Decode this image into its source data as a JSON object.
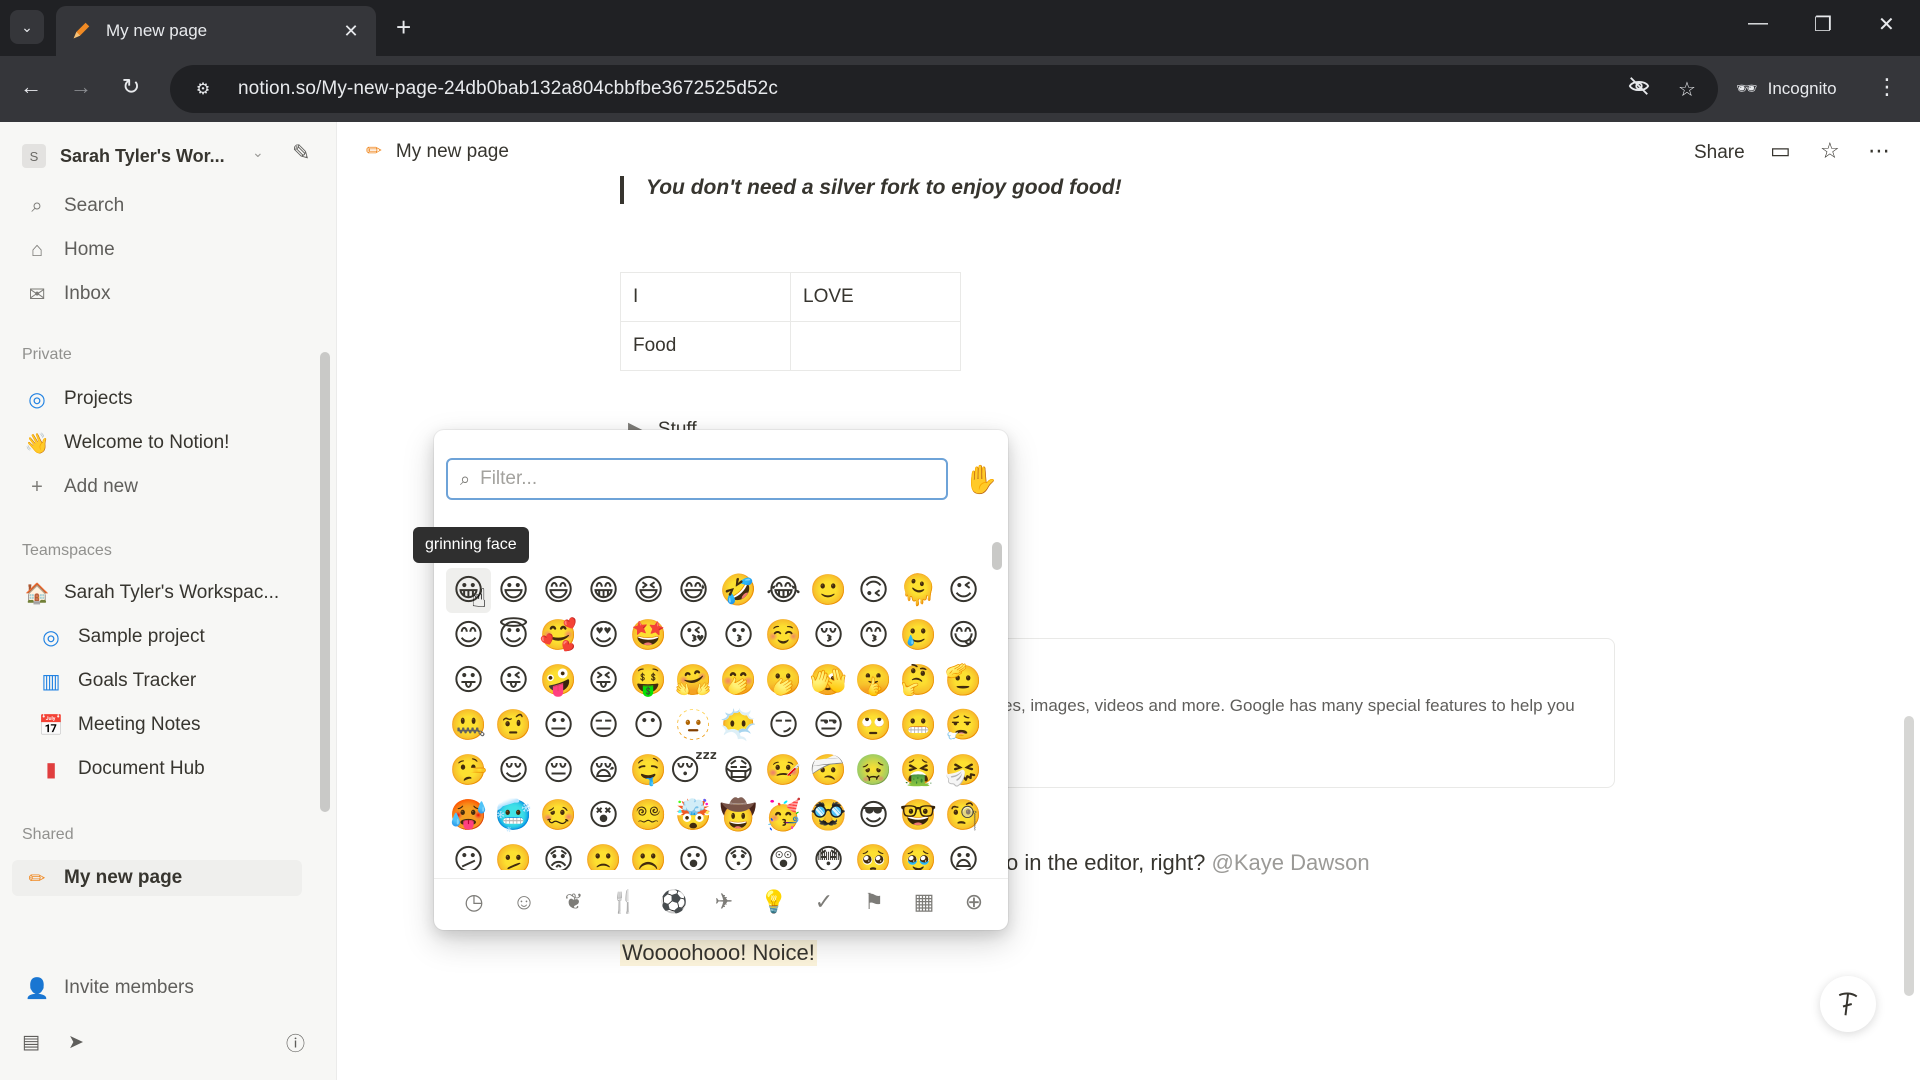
{
  "browser": {
    "tab_title": "My new page",
    "tab_close": "✕",
    "new_tab": "+",
    "url": "notion.so/My-new-page-24db0bab132a804cbbfbe3672525d52c",
    "incognito_label": "Incognito",
    "window_controls": [
      "—",
      "❐",
      "✕"
    ]
  },
  "sidebar": {
    "workspace_initial": "S",
    "workspace_name": "Sarah Tyler's Wor...",
    "search": "Search",
    "home": "Home",
    "inbox": "Inbox",
    "private_header": "Private",
    "projects": "Projects",
    "welcome": "Welcome to Notion!",
    "add_new": "Add new",
    "teamspaces_header": "Teamspaces",
    "teamspace_name": "Sarah Tyler's Workspac...",
    "sample_project": "Sample project",
    "goals_tracker": "Goals Tracker",
    "meeting_notes": "Meeting Notes",
    "document_hub": "Document Hub",
    "shared_header": "Shared",
    "my_new_page": "My new page",
    "invite_members": "Invite members"
  },
  "topbar": {
    "breadcrumb": "My new page",
    "share": "Share"
  },
  "content": {
    "quote": "You don't need a silver fork to enjoy good food!",
    "table": [
      [
        "I",
        "LOVE"
      ],
      [
        "Food",
        ""
      ]
    ],
    "toggle": "Stuff",
    "callout_text": "es, images, videos and more. Google has many special features to help you",
    "mention_line": "o in the editor, right?",
    "mention": "@Kaye Dawson",
    "highlight": "Woooohooo! Noice!"
  },
  "picker": {
    "placeholder": "Filter...",
    "filter_value": "",
    "skin_tone": "✋",
    "tooltip": "grinning face",
    "emojis": [
      "😀",
      "😃",
      "😄",
      "😁",
      "😆",
      "😅",
      "🤣",
      "😂",
      "🙂",
      "🙃",
      "🫠",
      "😉",
      "😊",
      "😇",
      "🥰",
      "😍",
      "🤩",
      "😘",
      "😗",
      "☺️",
      "😚",
      "😙",
      "🥲",
      "😋",
      "😛",
      "😜",
      "🤪",
      "😝",
      "🤑",
      "🤗",
      "🤭",
      "🫢",
      "🫣",
      "🤫",
      "🤔",
      "🫡",
      "🤐",
      "🤨",
      "😐",
      "😑",
      "😶",
      "🫥",
      "😶‍🌫️",
      "😏",
      "😒",
      "🙄",
      "😬",
      "😮‍💨",
      "🤥",
      "😌",
      "😔",
      "😪",
      "🤤",
      "😴",
      "😷",
      "🤒",
      "🤕",
      "🤢",
      "🤮",
      "🤧",
      "🥵",
      "🥶",
      "🥴",
      "😵",
      "😵‍💫",
      "🤯",
      "🤠",
      "🥳",
      "🥸",
      "😎",
      "🤓",
      "🧐",
      "😕",
      "🫤",
      "😟",
      "🙁",
      "☹️",
      "😮",
      "😯",
      "😲",
      "😳",
      "🥺",
      "🥹",
      "😦"
    ],
    "categories": [
      "clock-icon",
      "smiley-icon",
      "leaf-icon",
      "food-icon",
      "ball-icon",
      "plane-icon",
      "bulb-icon",
      "symbols-icon",
      "flag-icon",
      "grid-icon",
      "plus-circle-icon"
    ]
  },
  "colors": {
    "accent": "#6ea3d8",
    "highlight_bg": "#fbf3db"
  }
}
